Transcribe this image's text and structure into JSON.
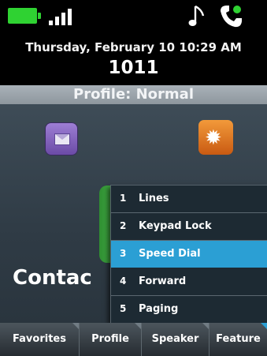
{
  "status": {
    "battery_color": "#2fd232",
    "icons": [
      "battery-icon",
      "signal-icon",
      "music-note-icon",
      "handset-icon"
    ]
  },
  "header": {
    "datetime": "Thursday, February 10 10:29 AM",
    "extension": "1011"
  },
  "profile": {
    "label": "Profile: Normal"
  },
  "home": {
    "apps": [
      {
        "name": "messages",
        "icon": "envelope-icon"
      },
      {
        "name": "settings",
        "icon": "gears-icon"
      },
      {
        "name": "contacts",
        "icon": "contacts-icon"
      }
    ],
    "contacts_label": "Contac"
  },
  "menu": {
    "items": [
      {
        "num": "1",
        "label": "Lines"
      },
      {
        "num": "2",
        "label": "Keypad Lock"
      },
      {
        "num": "3",
        "label": "Speed Dial"
      },
      {
        "num": "4",
        "label": "Forward"
      },
      {
        "num": "5",
        "label": "Paging"
      }
    ],
    "selected_index": 2,
    "highlight_color": "#2b9fd4"
  },
  "softkeys": [
    {
      "label": "Favorites"
    },
    {
      "label": "Profile"
    },
    {
      "label": "Speaker"
    },
    {
      "label": "Feature"
    }
  ]
}
